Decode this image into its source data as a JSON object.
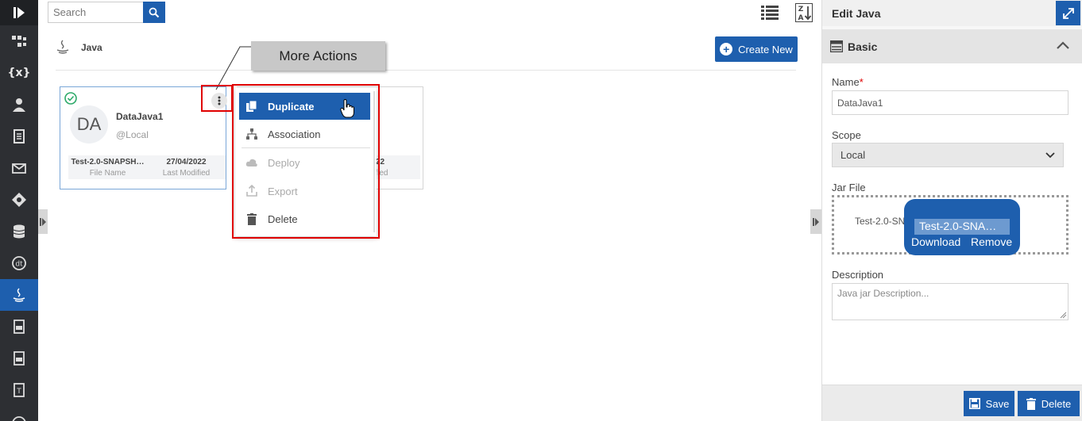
{
  "search": {
    "placeholder": "Search"
  },
  "sidebar": {
    "items": [
      {
        "icon": "logo-icon"
      },
      {
        "icon": "workflow-icon"
      },
      {
        "icon": "variables-icon",
        "glyph": "{x}"
      },
      {
        "icon": "user-icon"
      },
      {
        "icon": "document-icon"
      },
      {
        "icon": "mail-icon"
      },
      {
        "icon": "diamond-icon"
      },
      {
        "icon": "database-icon"
      },
      {
        "icon": "dt-icon"
      },
      {
        "icon": "java-icon",
        "active": true
      },
      {
        "icon": "ts-file-icon"
      },
      {
        "icon": "css-file-icon"
      },
      {
        "icon": "text-file-icon"
      },
      {
        "icon": "info-icon"
      }
    ]
  },
  "section": {
    "title": "Java"
  },
  "toolbar": {
    "create_label": "Create New"
  },
  "card": {
    "initials": "DA",
    "name": "DataJava1",
    "scope": "@Local",
    "file_name": "Test-2.0-SNAPSH…",
    "file_name_label": "File Name",
    "last_modified": "27/04/2022",
    "last_modified_label": "Last Modified"
  },
  "card2": {
    "last_modified": "/2022",
    "last_modified_label": "odified"
  },
  "callout": {
    "text": "More Actions"
  },
  "menu": {
    "items": [
      {
        "label": "Duplicate",
        "icon": "duplicate-icon",
        "state": "selected"
      },
      {
        "label": "Association",
        "icon": "hierarchy-icon",
        "state": "normal"
      },
      {
        "label": "Deploy",
        "icon": "cloud-upload-icon",
        "state": "disabled"
      },
      {
        "label": "Export",
        "icon": "export-icon",
        "state": "disabled"
      },
      {
        "label": "Delete",
        "icon": "trash-icon",
        "state": "normal"
      }
    ]
  },
  "panel": {
    "title": "Edit Java",
    "section_title": "Basic",
    "name_label": "Name",
    "name_required": "*",
    "name_value": "DataJava1",
    "scope_label": "Scope",
    "scope_value": "Local",
    "jar_label": "Jar File",
    "jar_filename": "Test-2.0-SN",
    "jar_tooltip_name": "Test-2.0-SNA…",
    "jar_download": "Download",
    "jar_remove": "Remove",
    "description_label": "Description",
    "description_placeholder": "Java jar Description...",
    "save_label": "Save",
    "delete_label": "Delete"
  },
  "colors": {
    "accent": "#1e5fae",
    "sidebar": "#2d2f33",
    "highlight": "#e00000",
    "success": "#2eaa6a"
  }
}
